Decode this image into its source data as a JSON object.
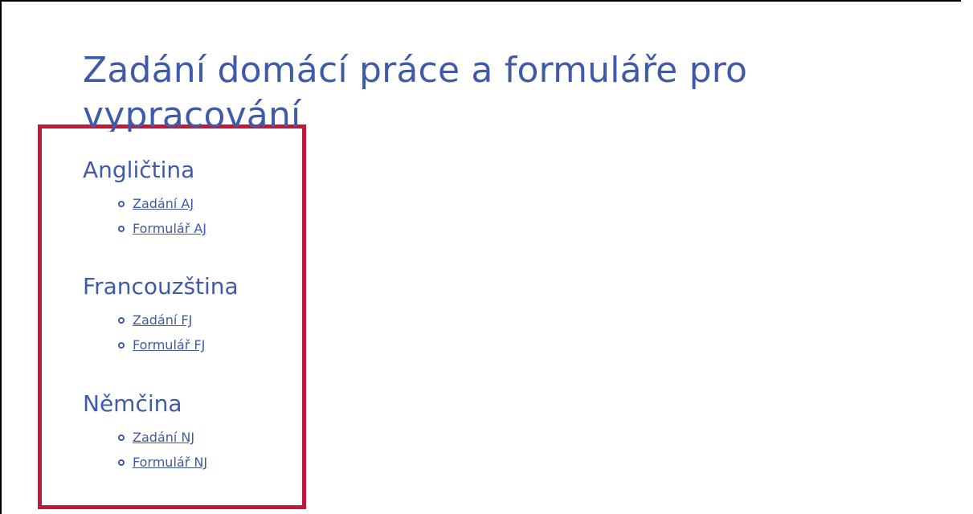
{
  "page": {
    "title": "Zadání domácí práce a formuláře pro vypracování"
  },
  "sections": [
    {
      "heading": "Angličtina",
      "links": [
        "Zadání AJ",
        "Formulář AJ"
      ]
    },
    {
      "heading": "Francouzština",
      "links": [
        "Zadání FJ",
        "Formulář FJ"
      ]
    },
    {
      "heading": "Němčina",
      "links": [
        "Zadání NJ",
        "Formulář NJ"
      ]
    }
  ],
  "colors": {
    "text": "#3f5aa8",
    "highlight_border": "#c2183a",
    "frame": "#000000"
  },
  "icons": {
    "bullet": "circle-bullet-icon"
  }
}
